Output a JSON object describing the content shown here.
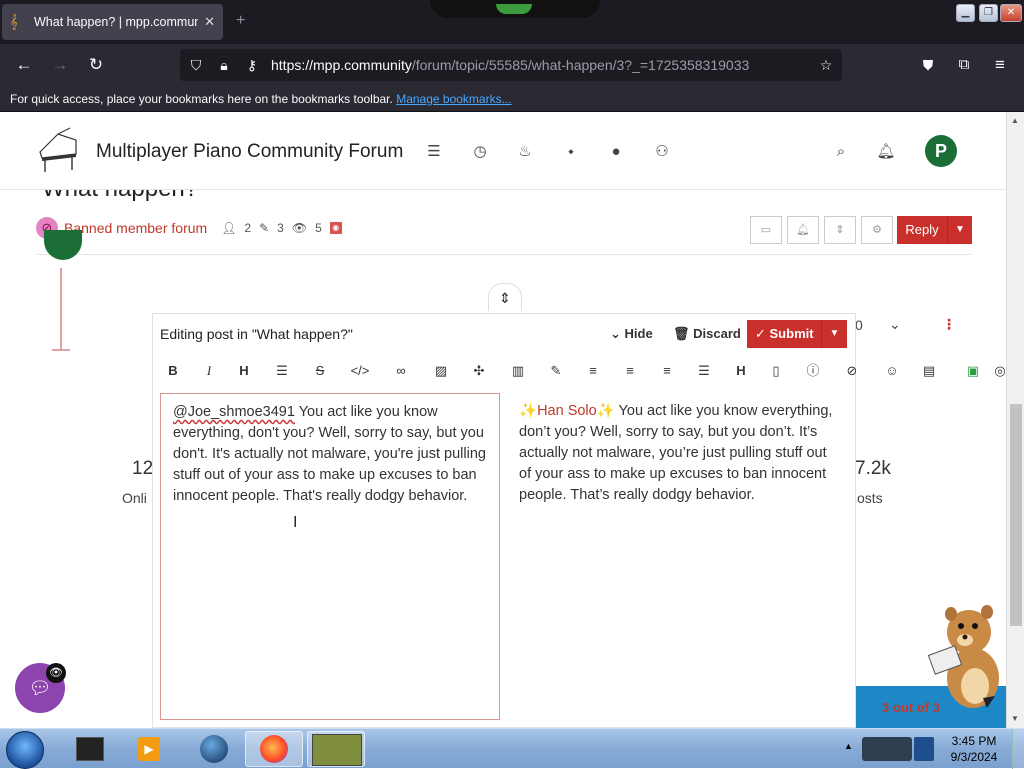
{
  "browser": {
    "tab_title": "What happen? | mpp.communi",
    "url_host": "https://mpp.community",
    "url_path": "/forum/topic/55585/what-happen/3?_=1725358319033",
    "bookmarks_text": "For quick access, place your bookmarks here on the bookmarks toolbar.",
    "bookmarks_link": "Manage bookmarks..."
  },
  "site": {
    "title": "Multiplayer Piano Community Forum",
    "avatar_letter": "P"
  },
  "topic": {
    "title": "What happen?",
    "category": "Banned member forum",
    "posters": "2",
    "posts": "3",
    "views": "5",
    "reply_label": "Reply"
  },
  "background": {
    "stat_left": "12",
    "stat_left_label": "Onli",
    "stat_right": "7.2k",
    "stat_right_label": "osts",
    "post_count": "0"
  },
  "composer": {
    "heading": "Editing post in \"What happen?\"",
    "hide_label": "Hide",
    "discard_label": "Discard",
    "submit_label": "Submit",
    "editor_mention": "@Joe_shmoe3491",
    "editor_body": " You act like you know everything, don't you? Well, sorry to say, but you don't. It's actually not malware, you're just pulling stuff out of your ass to make up excuses to ban innocent people. That's really dodgy behavior.",
    "preview_name": "Han Solo",
    "preview_body": " You act like you know everything, don’t you? Well, sorry to say, but you don’t. It’s actually not malware, you’re just pulling stuff out of your ass to make up excuses to ban innocent people. That’s really dodgy behavior."
  },
  "pager": {
    "text": "3 out of 3"
  },
  "taskbar": {
    "time": "3:45 PM",
    "date": "9/3/2024"
  },
  "colors": {
    "accent": "#c9302c",
    "avatar": "#1b6e35",
    "chat": "#8e44ad",
    "pager": "#1e88c7"
  }
}
